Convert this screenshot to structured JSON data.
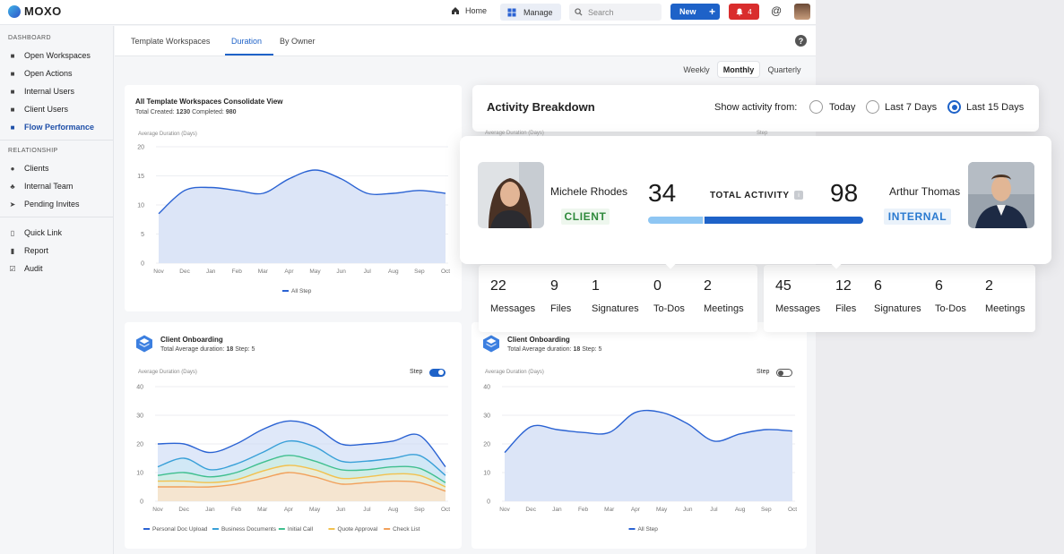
{
  "topbar": {
    "brand": "MOXO",
    "home": "Home",
    "manage": "Manage",
    "search_placeholder": "Search",
    "new_label": "New",
    "notification_count": "4"
  },
  "sidebar": {
    "dashboard_heading": "DASHBOARD",
    "dashboard_items": [
      {
        "label": "Open Workspaces"
      },
      {
        "label": "Open Actions"
      },
      {
        "label": "Internal Users"
      },
      {
        "label": "Client Users"
      },
      {
        "label": "Flow Performance"
      }
    ],
    "relationship_heading": "RELATIONSHIP",
    "relationship_items": [
      {
        "label": "Clients"
      },
      {
        "label": "Internal Team"
      },
      {
        "label": "Pending Invites"
      }
    ],
    "other_items": [
      {
        "label": "Quick Link"
      },
      {
        "label": "Report"
      },
      {
        "label": "Audit"
      }
    ]
  },
  "tabs": [
    {
      "label": "Template Workspaces"
    },
    {
      "label": "Duration"
    },
    {
      "label": "By Owner"
    }
  ],
  "period": [
    {
      "label": "Weekly"
    },
    {
      "label": "Monthly"
    },
    {
      "label": "Quarterly"
    }
  ],
  "consolidated": {
    "title": "All Template Workspaces Consolidate View",
    "created_label": "Total Created:",
    "created_value": "1230",
    "completed_label": "Completed:",
    "completed_value": "980",
    "axis_title": "Average Duration (Days)"
  },
  "onboarding_left": {
    "title": "Client Onboarding",
    "avg_label": "Total Average duration:",
    "avg_value": "18",
    "step_label": "Step:",
    "step_value": "5",
    "axis_title": "Average Duration (Days)",
    "toggle_label": "Step",
    "toggle_on": true
  },
  "onboarding_right": {
    "title": "Client Onboarding",
    "avg_label": "Total Average duration:",
    "avg_value": "18",
    "step_label": "Step:",
    "step_value": "5",
    "axis_title": "Average Duration (Days)",
    "toggle_label": "Step",
    "toggle_on": false
  },
  "activity": {
    "title": "Activity Breakdown",
    "show_label": "Show activity from:",
    "options": [
      {
        "label": "Today",
        "selected": false
      },
      {
        "label": "Last 7 Days",
        "selected": false
      },
      {
        "label": "Last 15 Days",
        "selected": true
      }
    ],
    "ghost_axis": "Average Duration (Days)",
    "ghost_step": "Step"
  },
  "total_activity": {
    "label": "TOTAL ACTIVITY",
    "left": {
      "name": "Michele Rhodes",
      "role": "CLIENT",
      "total": "34"
    },
    "right": {
      "name": "Arthur Thomas",
      "role": "INTERNAL",
      "total": "98"
    },
    "bar_share_left": 0.258
  },
  "stats": {
    "left": [
      {
        "value": "22",
        "label": "Messages"
      },
      {
        "value": "9",
        "label": "Files"
      },
      {
        "value": "1",
        "label": "Signatures"
      },
      {
        "value": "0",
        "label": "To-Dos"
      },
      {
        "value": "2",
        "label": "Meetings"
      }
    ],
    "right": [
      {
        "value": "45",
        "label": "Messages"
      },
      {
        "value": "12",
        "label": "Files"
      },
      {
        "value": "6",
        "label": "Signatures"
      },
      {
        "value": "6",
        "label": "To-Dos"
      },
      {
        "value": "2",
        "label": "Meetings"
      }
    ]
  },
  "colors": {
    "accent": "#1e62c8",
    "area_fill": "#dce5f7",
    "line": "#2b63d3",
    "notif": "#d92d2d"
  },
  "chart_data": [
    {
      "type": "area",
      "title": "All Template Workspaces Consolidate View",
      "ylabel": "Average Duration (Days)",
      "x": [
        "Nov",
        "Dec",
        "Jan",
        "Feb",
        "Mar",
        "Apr",
        "May",
        "Jun",
        "Jul",
        "Aug",
        "Sep",
        "Oct"
      ],
      "series": [
        {
          "name": "All Step",
          "values": [
            8.5,
            12.5,
            13,
            12.5,
            12,
            14.5,
            16,
            14.5,
            12,
            12,
            12.5,
            12
          ]
        }
      ],
      "ylim": [
        0,
        20
      ],
      "yticks": [
        0,
        5,
        10,
        15,
        20
      ],
      "grid": true,
      "legend": "bottom"
    },
    {
      "type": "area",
      "title": "Client Onboarding",
      "ylabel": "Average Duration (Days)",
      "x": [
        "Nov",
        "Dec",
        "Jan",
        "Feb",
        "Mar",
        "Apr",
        "May",
        "Jun",
        "Jul",
        "Aug",
        "Sep",
        "Oct"
      ],
      "series": [
        {
          "name": "Personal Doc Upload",
          "color": "#2b63d3",
          "values": [
            20,
            20,
            17,
            20,
            25,
            28,
            26,
            20,
            20,
            21,
            23,
            12
          ]
        },
        {
          "name": "Business Documents",
          "color": "#39a0d8",
          "values": [
            12,
            15,
            11,
            13,
            17,
            21,
            19,
            14,
            14,
            15,
            16,
            9
          ]
        },
        {
          "name": "Initial Call",
          "color": "#3fbf8f",
          "values": [
            9,
            10,
            8.5,
            10,
            13.5,
            16,
            14,
            11,
            11,
            12,
            11.5,
            6.5
          ]
        },
        {
          "name": "Quote Approval",
          "color": "#f2c14e",
          "values": [
            7,
            7,
            6.5,
            7.5,
            10.5,
            12.5,
            11,
            8,
            8.5,
            9.5,
            9,
            5
          ]
        },
        {
          "name": "Check List",
          "color": "#f2a05a",
          "values": [
            5,
            5,
            5,
            6,
            8,
            10,
            8.5,
            6,
            6.5,
            7,
            6.5,
            3.5
          ]
        }
      ],
      "ylim": [
        0,
        40
      ],
      "yticks": [
        0,
        10,
        20,
        30,
        40
      ],
      "grid": true,
      "legend": "bottom"
    },
    {
      "type": "area",
      "title": "Client Onboarding",
      "ylabel": "Average Duration (Days)",
      "x": [
        "Nov",
        "Dec",
        "Jan",
        "Feb",
        "Mar",
        "Apr",
        "May",
        "Jun",
        "Jul",
        "Aug",
        "Sep",
        "Oct"
      ],
      "series": [
        {
          "name": "All Step",
          "values": [
            17,
            26,
            25,
            24,
            24,
            31,
            31,
            27,
            21,
            23.5,
            25,
            24.5
          ]
        }
      ],
      "ylim": [
        0,
        40
      ],
      "yticks": [
        0,
        10,
        20,
        30,
        40
      ],
      "grid": true,
      "legend": "bottom"
    }
  ]
}
